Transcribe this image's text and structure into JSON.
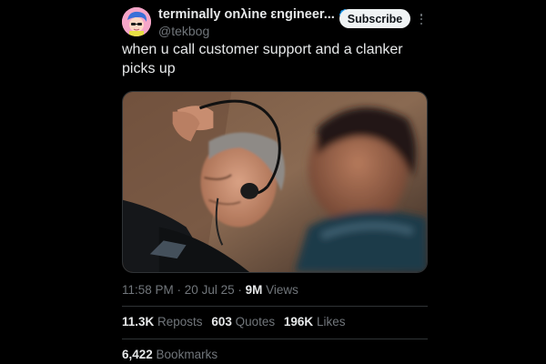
{
  "author": {
    "display_name": "terminally onλine εngineer...",
    "handle": "@tekbog",
    "avatar": "pink-avatar-with-blue-hair",
    "verified_icon": "verified-badge-icon"
  },
  "actions": {
    "subscribe_label": "Subscribe",
    "more_icon": "more-dots-icon"
  },
  "tweet": {
    "text": "when u call customer support and a clanker picks up",
    "media": "photo-two-men-headset"
  },
  "meta": {
    "time": "11:58 PM",
    "separator1": " · ",
    "date": "20 Jul 25",
    "separator2": " · ",
    "views_count": "9M",
    "views_label": " Views"
  },
  "stats": {
    "reposts_count": "11.3K",
    "reposts_label": " Reposts",
    "quotes_count": "603",
    "quotes_label": " Quotes",
    "likes_count": "196K",
    "likes_label": " Likes",
    "bookmarks_count": "6,422",
    "bookmarks_label": " Bookmarks"
  },
  "colors": {
    "background": "#000000",
    "text_primary": "#e7e9ea",
    "text_secondary": "#71767b",
    "divider": "#2f3336",
    "verified": "#1d9bf0",
    "button_bg": "#eff3f4"
  }
}
